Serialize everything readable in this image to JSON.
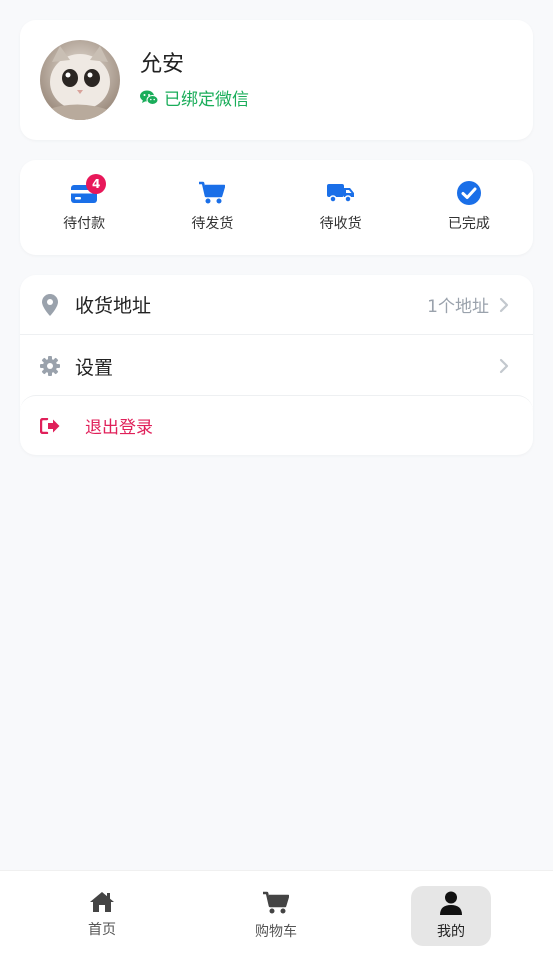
{
  "profile": {
    "name": "允安",
    "wechat_status": "已绑定微信"
  },
  "orders": [
    {
      "label": "待付款",
      "icon": "card-icon",
      "badge": "4"
    },
    {
      "label": "待发货",
      "icon": "cart-icon"
    },
    {
      "label": "待收货",
      "icon": "truck-icon"
    },
    {
      "label": "已完成",
      "icon": "check-circle-icon"
    }
  ],
  "menu": {
    "address": {
      "label": "收货地址",
      "value": "1个地址"
    },
    "settings": {
      "label": "设置"
    },
    "logout": {
      "label": "退出登录"
    }
  },
  "bottom_nav": [
    {
      "label": "首页",
      "icon": "home-icon"
    },
    {
      "label": "购物车",
      "icon": "cart-icon"
    },
    {
      "label": "我的",
      "icon": "user-icon",
      "active": true
    }
  ],
  "colors": {
    "accent": "#1a6fe8",
    "wechat_green": "#1aad5a",
    "badge_red": "#e8185a",
    "logout_red": "#e0205a",
    "muted": "#9aa2ac"
  }
}
